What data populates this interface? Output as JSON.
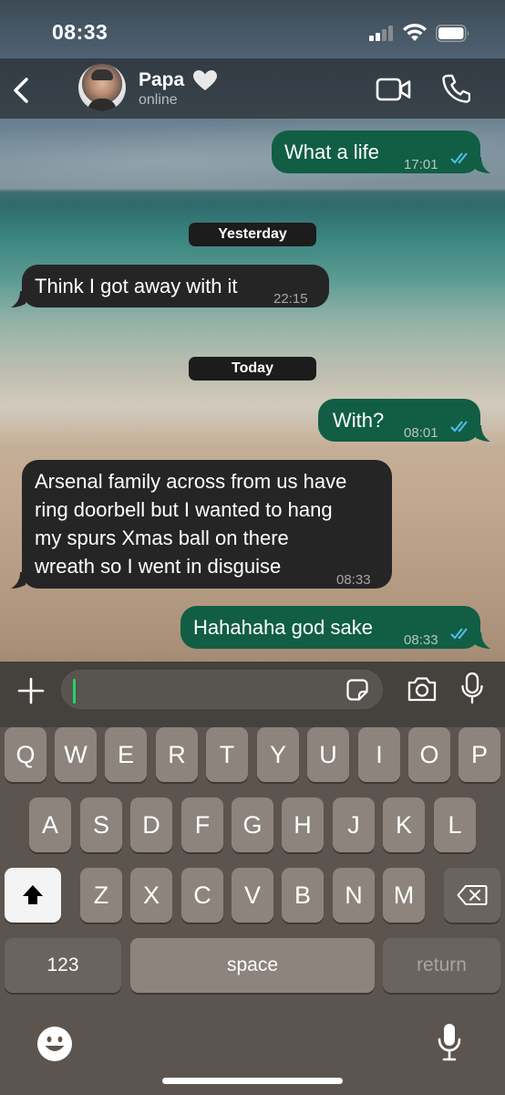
{
  "status_bar": {
    "time": "08:33"
  },
  "header": {
    "contact_name": "Papa",
    "contact_status": "online",
    "icons": [
      "back-chevron-icon",
      "heart-icon",
      "video-camera-icon",
      "phone-icon"
    ]
  },
  "chat": {
    "messages": [
      {
        "direction": "out",
        "text": "What a life",
        "time": "17:01",
        "read": true
      },
      {
        "type": "date",
        "text": "Yesterday"
      },
      {
        "direction": "in",
        "text": "Think I got away with it",
        "time": "22:15"
      },
      {
        "type": "date",
        "text": "Today"
      },
      {
        "direction": "out",
        "text": "With?",
        "time": "08:01",
        "read": true
      },
      {
        "direction": "in",
        "lines": [
          "Arsenal family across from us have",
          "ring doorbell but I wanted to hang",
          "my spurs Xmas ball on there",
          "wreath so I went in disguise"
        ],
        "time": "08:33"
      },
      {
        "direction": "out",
        "text": "Hahahaha god sake",
        "time": "08:33",
        "read": true
      }
    ]
  },
  "input_bar": {
    "value": "",
    "icons": [
      "plus-icon",
      "sticker-icon",
      "camera-icon",
      "microphone-icon"
    ]
  },
  "keyboard": {
    "row1": [
      "Q",
      "W",
      "E",
      "R",
      "T",
      "Y",
      "U",
      "I",
      "O",
      "P"
    ],
    "row2": [
      "A",
      "S",
      "D",
      "F",
      "G",
      "H",
      "J",
      "K",
      "L"
    ],
    "row3": [
      "Z",
      "X",
      "C",
      "V",
      "B",
      "N",
      "M"
    ],
    "numbers_label": "123",
    "space_label": "space",
    "return_label": "return",
    "colors": {
      "key": "#8c847d",
      "dark_key": "#6b645e",
      "background": "#5c554f"
    }
  },
  "colors": {
    "outgoing_bubble": "#115e44",
    "incoming_bubble": "#252526",
    "read_ticks": "#53bdeb"
  }
}
